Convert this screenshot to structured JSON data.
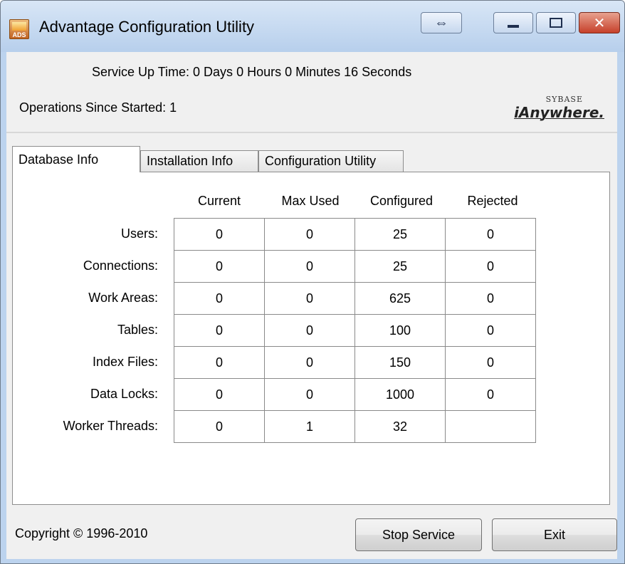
{
  "window": {
    "title": "Advantage Configuration Utility",
    "icon_text": "ADS",
    "resize_glyph": "⇔",
    "close_glyph": "✕"
  },
  "status": {
    "uptime": "Service Up Time:  0 Days 0 Hours 0 Minutes 16 Seconds",
    "operations": "Operations Since Started: 1",
    "logo_top": "SYBASE",
    "logo_main": "iAnywhere."
  },
  "tabs": [
    "Database Info",
    "Installation Info",
    "Configuration Utility"
  ],
  "table": {
    "columns": [
      "Current",
      "Max Used",
      "Configured",
      "Rejected"
    ],
    "rows": [
      {
        "label": "Users:",
        "values": [
          "0",
          "0",
          "25",
          "0"
        ]
      },
      {
        "label": "Connections:",
        "values": [
          "0",
          "0",
          "25",
          "0"
        ]
      },
      {
        "label": "Work Areas:",
        "values": [
          "0",
          "0",
          "625",
          "0"
        ]
      },
      {
        "label": "Tables:",
        "values": [
          "0",
          "0",
          "100",
          "0"
        ]
      },
      {
        "label": "Index Files:",
        "values": [
          "0",
          "0",
          "150",
          "0"
        ]
      },
      {
        "label": "Data Locks:",
        "values": [
          "0",
          "0",
          "1000",
          "0"
        ]
      },
      {
        "label": "Worker Threads:",
        "values": [
          "0",
          "1",
          "32",
          ""
        ]
      }
    ]
  },
  "footer": {
    "copyright": "Copyright © 1996-2010",
    "stop_label": "Stop Service",
    "exit_label": "Exit"
  }
}
